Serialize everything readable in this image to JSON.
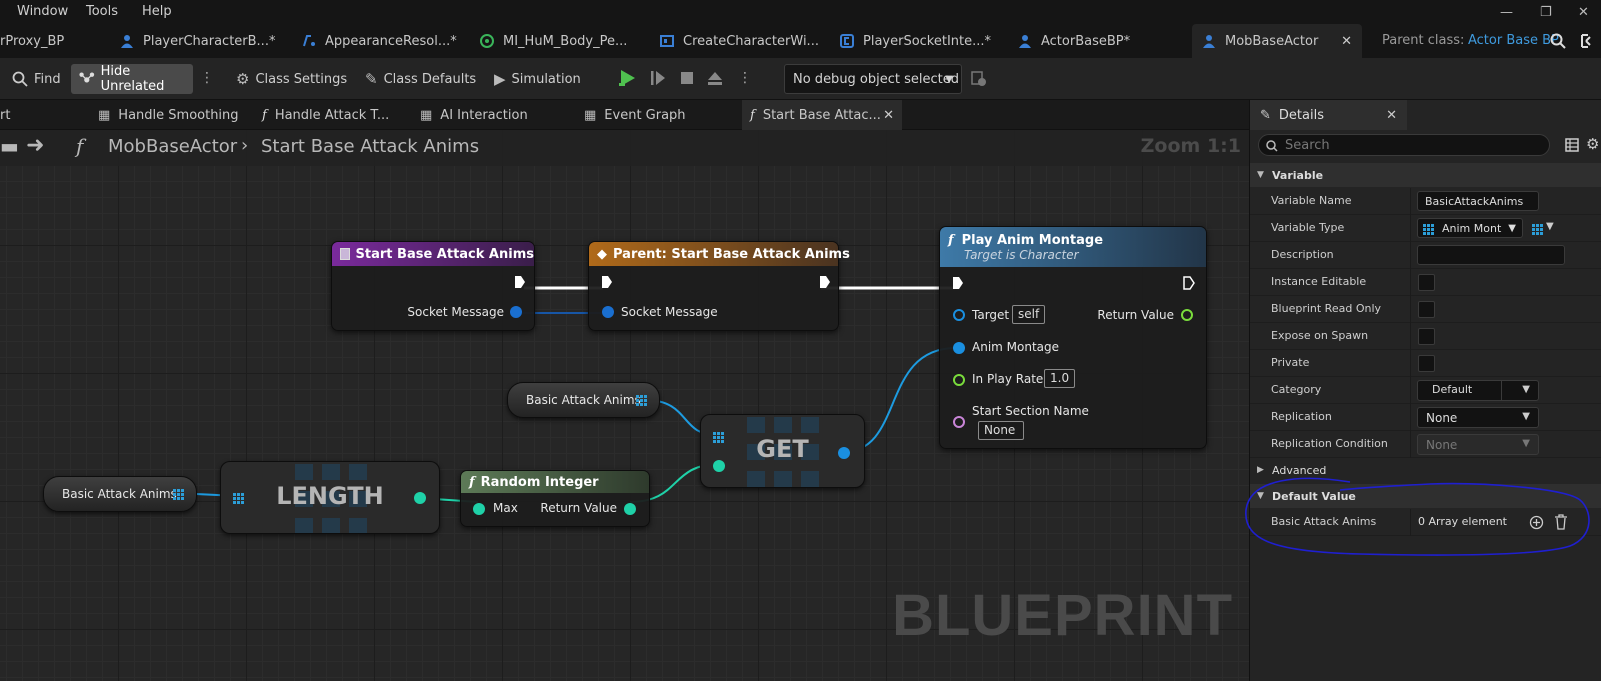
{
  "menubar": {
    "items": [
      "Window",
      "Tools",
      "Help"
    ]
  },
  "tabs": [
    {
      "label": "rProxy_BP"
    },
    {
      "label": "PlayerCharacterB...*"
    },
    {
      "label": "AppearanceResol...*"
    },
    {
      "label": "MI_HuM_Body_Pe..."
    },
    {
      "label": "CreateCharacterWi..."
    },
    {
      "label": "PlayerSocketInte...*"
    },
    {
      "label": "ActorBaseBP*"
    },
    {
      "label": "MobBaseActor"
    }
  ],
  "parent_class": {
    "label": "Parent class:",
    "value": "Actor Base BP"
  },
  "toolbar": {
    "find": "Find",
    "hide_unrelated": "Hide Unrelated",
    "class_settings": "Class Settings",
    "class_defaults": "Class Defaults",
    "simulation": "Simulation",
    "debug_object": "No debug object selected"
  },
  "graph_tabs": [
    "rt",
    "Handle Smoothing",
    "Handle Attack T...",
    "AI Interaction",
    "Event Graph",
    "Start Base Attac..."
  ],
  "breadcrumb": {
    "blueprint": "MobBaseActor",
    "function": "Start Base Attack Anims",
    "zoom": "Zoom 1:1"
  },
  "watermark": "BLUEPRINT",
  "nodes": {
    "entry": {
      "title": "Start Base Attack Anims",
      "pin": "Socket Message"
    },
    "parent": {
      "title": "Parent: Start Base Attack Anims",
      "pin": "Socket Message"
    },
    "play_montage": {
      "title": "Play Anim Montage",
      "subtitle": "Target is Character",
      "target": "Target",
      "target_default": "self",
      "anim_montage": "Anim Montage",
      "play_rate": "In Play Rate",
      "play_rate_default": "1.0",
      "section": "Start Section Name",
      "section_default": "None",
      "return": "Return Value"
    },
    "var_get_top": {
      "label": "Basic Attack Anims"
    },
    "var_get_left": {
      "label": "Basic Attack Anims"
    },
    "length": {
      "title": "LENGTH"
    },
    "get": {
      "title": "GET"
    },
    "random_int": {
      "title": "Random Integer",
      "max": "Max",
      "return": "Return Value"
    }
  },
  "details": {
    "tab": "Details",
    "search_placeholder": "Search",
    "variable_section": "Variable",
    "rows": [
      {
        "label": "Variable Name",
        "value": "BasicAttackAnims"
      },
      {
        "label": "Variable Type",
        "value": "Anim Mont"
      },
      {
        "label": "Description",
        "value": ""
      },
      {
        "label": "Instance Editable"
      },
      {
        "label": "Blueprint Read Only"
      },
      {
        "label": "Expose on Spawn"
      },
      {
        "label": "Private"
      },
      {
        "label": "Category",
        "value": "Default"
      },
      {
        "label": "Replication",
        "value": "None"
      },
      {
        "label": "Replication Condition",
        "value": "None"
      }
    ],
    "advanced_section": "Advanced",
    "default_value_section": "Default Value",
    "default_row": {
      "label": "Basic Attack Anims",
      "value": "0 Array element"
    }
  },
  "colors": {
    "annotation": "#1f1fd0",
    "exec_white": "#ffffff",
    "object_pin": "#1a8fe0",
    "int_pin": "#1fd1a8",
    "float_pin": "#7adc3c",
    "name_pin": "#c985d8"
  }
}
